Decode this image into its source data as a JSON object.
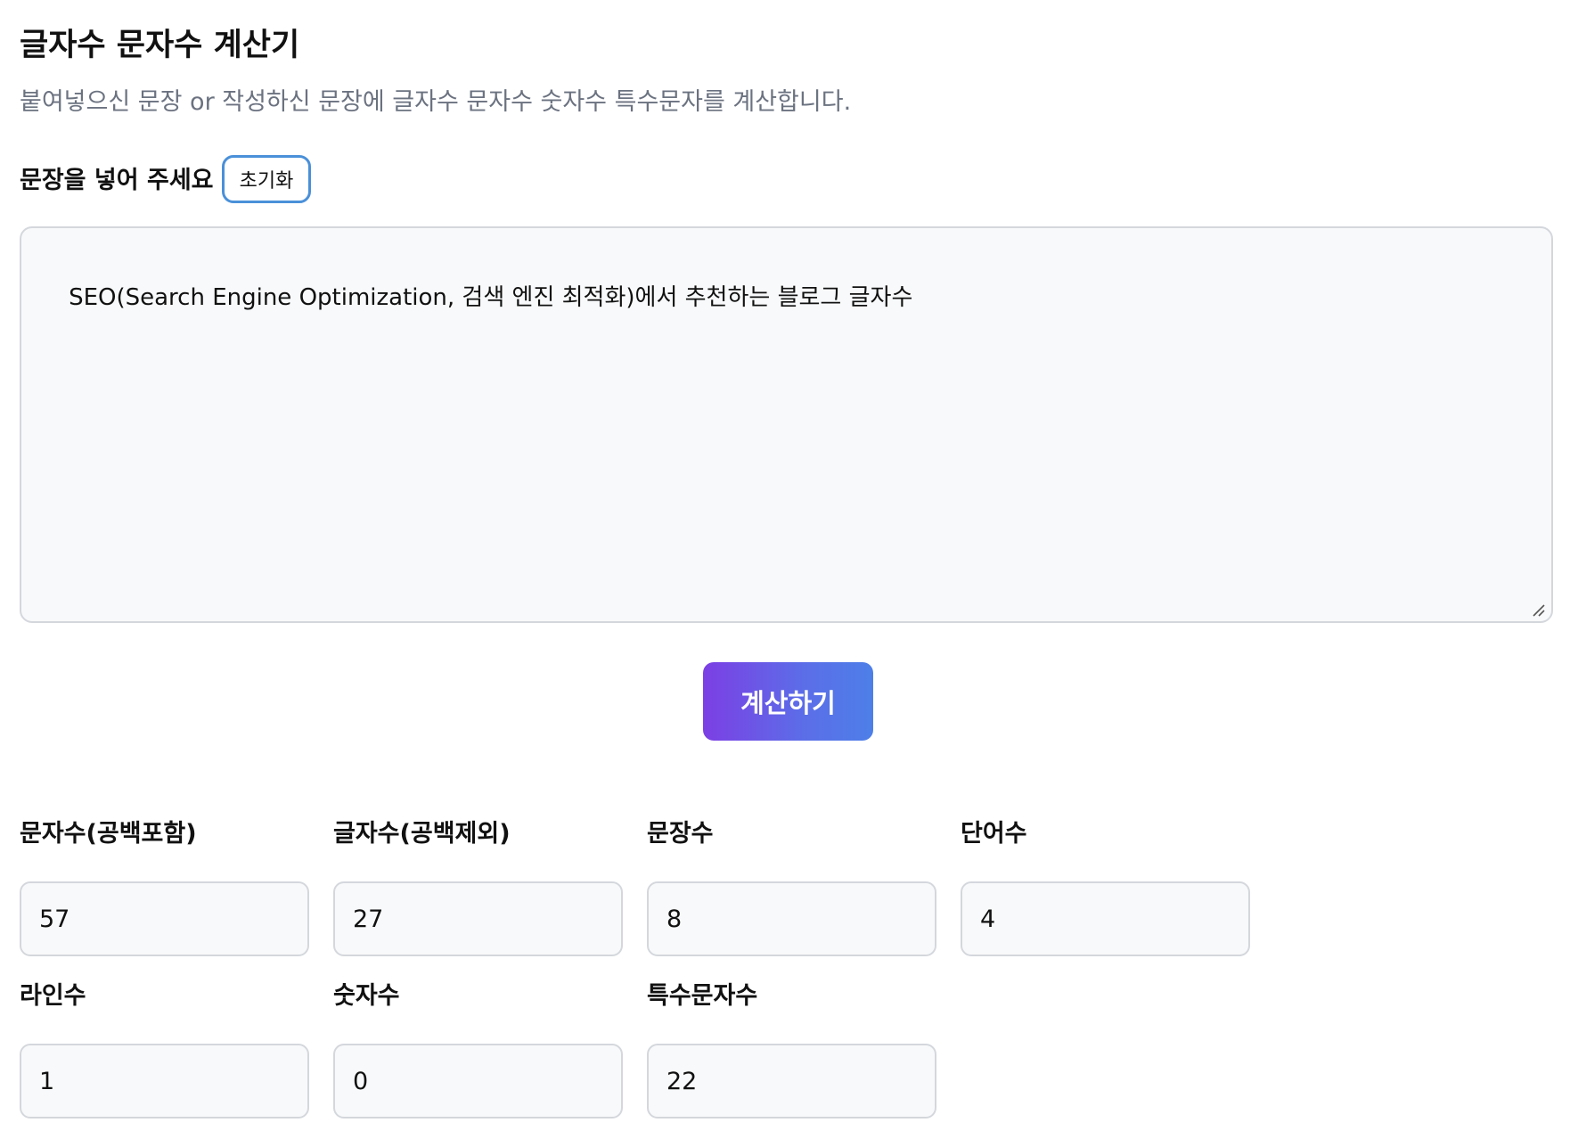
{
  "header": {
    "title": "글자수 문자수 계산기",
    "subtitle": "붙여넣으신 문장 or 작성하신 문장에 글자수 문자수 숫자수 특수문자를 계산합니다."
  },
  "input": {
    "label": "문장을 넣어 주세요",
    "reset_label": "초기화",
    "value": "SEO(Search Engine Optimization, 검색 엔진 최적화)에서 추천하는 블로그 글자수"
  },
  "calculate_label": "계산하기",
  "stats": [
    {
      "label": "문자수(공백포함)",
      "value": "57"
    },
    {
      "label": "글자수(공백제외)",
      "value": "27"
    },
    {
      "label": "문장수",
      "value": "8"
    },
    {
      "label": "단어수",
      "value": "4"
    },
    {
      "label": "라인수",
      "value": "1"
    },
    {
      "label": "숫자수",
      "value": "0"
    },
    {
      "label": "특수문자수",
      "value": "22"
    }
  ],
  "colors": {
    "reset_border": "#4a90d9",
    "calc_gradient_start": "#7c3fe4",
    "calc_gradient_end": "#4d7fe8",
    "field_bg": "#f8f9fa",
    "field_border": "#d4d7dc",
    "subtitle": "#6b7280"
  }
}
